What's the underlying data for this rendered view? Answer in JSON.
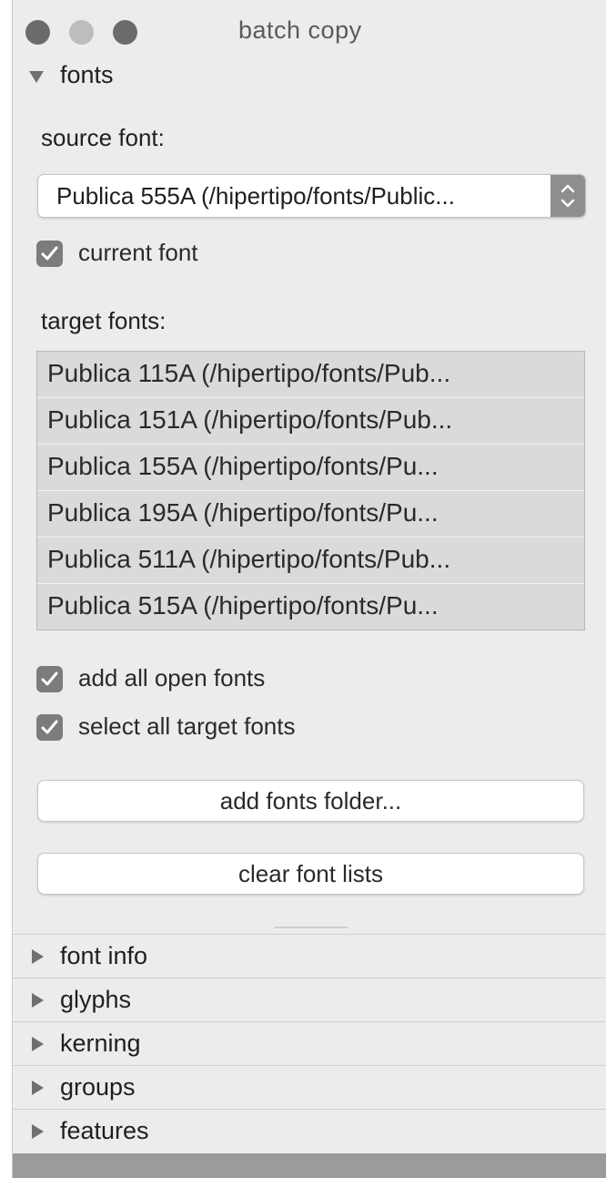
{
  "window": {
    "title": "batch copy"
  },
  "fonts_section": {
    "label": "fonts",
    "source_font_label": "source font:",
    "source_font_selected": "Publica 555A (/hipertipo/fonts/Public...",
    "current_font_label": "current font",
    "current_font_checked": true,
    "target_fonts_label": "target fonts:",
    "target_fonts": [
      "Publica 115A (/hipertipo/fonts/Pub...",
      "Publica 151A (/hipertipo/fonts/Pub...",
      "Publica 155A (/hipertipo/fonts/Pu...",
      "Publica 195A (/hipertipo/fonts/Pu...",
      "Publica 511A (/hipertipo/fonts/Pub...",
      "Publica 515A (/hipertipo/fonts/Pu..."
    ],
    "add_all_open_fonts_label": "add all open fonts",
    "add_all_open_fonts_checked": true,
    "select_all_target_fonts_label": "select all target fonts",
    "select_all_target_fonts_checked": true,
    "add_fonts_folder_button": "add fonts folder...",
    "clear_font_lists_button": "clear font lists"
  },
  "collapsed_sections": [
    "font info",
    "glyphs",
    "kerning",
    "groups",
    "features"
  ],
  "colors": {
    "window_bg": "#ececec",
    "checkbox": "#7c7c7c",
    "list_row": "#dadada"
  }
}
